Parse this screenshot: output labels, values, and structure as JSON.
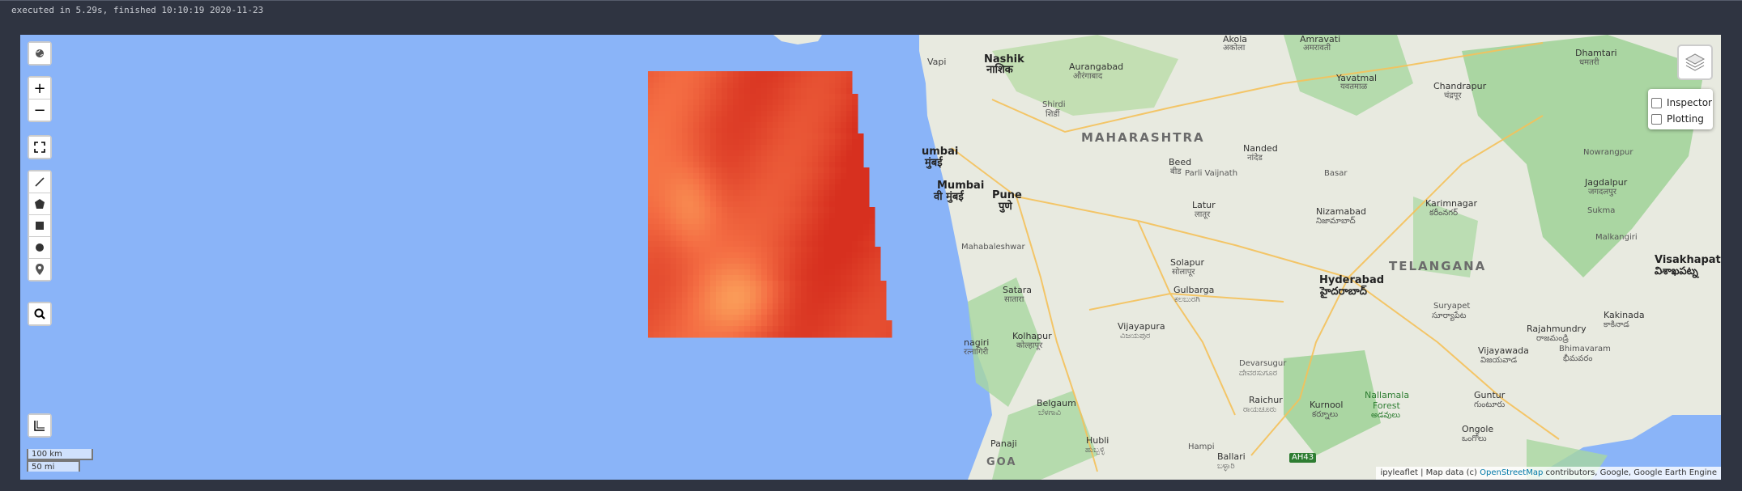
{
  "status": {
    "text": "executed in 5.29s, finished 10:10:19 2020-11-23"
  },
  "map": {
    "colors": {
      "ocean": "#8ab4f8",
      "land": "#e8eae0",
      "forest": "#a8d7a0",
      "road": "#f5c15a"
    },
    "labels": {
      "nashik": "Nashik",
      "nashik_alt": "नाशिक",
      "aurangabad": "Aurangabad",
      "aurangabad_alt": "औरंगाबाद",
      "amravati": "Amravati",
      "amravati_alt": "अमरावती",
      "akola": "Akola",
      "akola_alt": "अकोला",
      "yavatmal": "Yavatmal",
      "yavatmal_alt": "यवतमाळ",
      "chandrapur": "Chandrapur",
      "chandrapur_alt": "चंद्रपूर",
      "dhamtari": "Dhamtari",
      "dhamtari_alt": "धमतरी",
      "vapi": "Vapi",
      "mumbai1": "umbai",
      "mumbai1_alt": "मुंबई",
      "mumbai2": "Mumbai",
      "mumbai2_alt": "वी मुंबई",
      "pune": "Pune",
      "pune_alt": "पुणे",
      "shirdi": "Shirdi",
      "shirdi_alt": "शिर्डी",
      "maharashtra": "MAHARASHTRA",
      "nanded": "Nanded",
      "nanded_alt": "नांदेड",
      "beed": "Beed",
      "beed_alt": "बीड",
      "parli": "Parli Vaijnath",
      "basar": "Basar",
      "nowrangpur": "Nowrangpur",
      "jagdalpur": "Jagdalpur",
      "jagdalpur_alt": "जगदलपुर",
      "latur": "Latur",
      "latur_alt": "लातूर",
      "nizamabad": "Nizamabad",
      "nizamabad_alt": "నిజామాబాద్",
      "karimnagar": "Karimnagar",
      "karimnagar_alt": "కరీంనగర్",
      "sukma": "Sukma",
      "malkangiri": "Malkangiri",
      "mahabaleshwar": "Mahabaleshwar",
      "satara": "Satara",
      "satara_alt": "सातारा",
      "solapur": "Solapur",
      "solapur_alt": "सोलापूर",
      "telangana": "TELANGANA",
      "hyderabad": "Hyderabad",
      "hyderabad_alt": "హైదరాబాద్",
      "visakhapatnam": "Visakhapatnam",
      "visakhapatnam_alt": "విశాఖపట్న",
      "gulbarga": "Gulbarga",
      "gulbarga_alt": "ಕಲಬುರಗಿ",
      "suryapet": "Suryapet",
      "suryapet_alt": "సూర్యాపేట",
      "ratnagiri": "nagiri",
      "ratnagiri_alt": "रत्नागिरी",
      "kolhapur": "Kolhapur",
      "kolhapur_alt": "कोल्हापूर",
      "vijayapura": "Vijayapura",
      "vijayapura_alt": "ವಿಜಯಪುರ",
      "rajahmundry": "Rajahmundry",
      "rajahmundry_alt": "రాజమండ్రి",
      "kakinada": "Kakinada",
      "kakinada_alt": "కాకినాడ",
      "bhimavaram": "Bhimavaram",
      "bhimavaram_alt": "భీమవరం",
      "vijayawada": "Vijayawada",
      "vijayawada_alt": "విజయవాడ",
      "devarsugur": "Devarsugur",
      "devarsugur_alt": "ದೇವರಸುಗೂರ",
      "raichur": "Raichur",
      "raichur_alt": "ರಾಯಚೂರು",
      "kurnool": "Kurnool",
      "kurnool_alt": "కర్నూలు",
      "nallamala": "Nallamala",
      "nallamala2": "Forest",
      "nallamala_alt": "అడవులు",
      "guntur": "Guntur",
      "guntur_alt": "గుంటూరు",
      "ongole": "Ongole",
      "ongole_alt": "ఒంగోలు",
      "belgaum": "Belgaum",
      "belgaum_alt": "ಬೆಳಗಾವಿ",
      "hubli": "Hubli",
      "hubli_alt": "ಹುಬ್ಬಳ್ಳಿ",
      "hampi": "Hampi",
      "ballari": "Ballari",
      "ballari_alt": "ಬಳ್ಳಾರಿ",
      "panaji": "Panaji",
      "goa": "GOA",
      "ah43": "AH43"
    }
  },
  "controls": {
    "zoom_in": "+",
    "zoom_out": "−",
    "inspector": "Inspector",
    "plotting": "Plotting"
  },
  "scale": {
    "km": "100 km",
    "mi": "50 mi"
  },
  "attribution": {
    "prefix": "ipyleaflet | Map data (c) ",
    "link": "OpenStreetMap",
    "suffix": " contributors, Google, Google Earth Engine"
  },
  "overlay": {
    "description_colors": {
      "hot": "#d7301f",
      "mid": "#f46d43",
      "warm": "#fdae61",
      "cool": "#a6d96a"
    }
  }
}
